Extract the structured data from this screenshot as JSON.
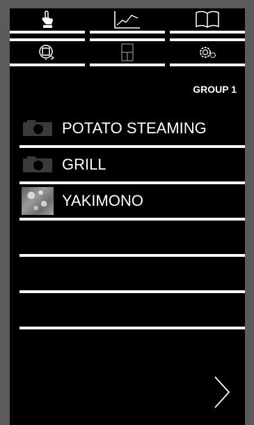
{
  "toolbar": {
    "row1": [
      {
        "icon": "hand-pointer-icon"
      },
      {
        "icon": "line-chart-icon"
      },
      {
        "icon": "book-icon"
      }
    ],
    "row2": [
      {
        "icon": "rotate-frame-icon"
      },
      {
        "icon": "oven-icon"
      },
      {
        "icon": "settings-gears-icon"
      }
    ]
  },
  "group": {
    "label": "GROUP 1"
  },
  "recipes": [
    {
      "name": "POTATO STEAMING",
      "thumb": "camera-icon"
    },
    {
      "name": "GRILL",
      "thumb": "camera-icon"
    },
    {
      "name": "YAKIMONO",
      "thumb": "photo"
    },
    {
      "name": "",
      "thumb": ""
    },
    {
      "name": "",
      "thumb": ""
    },
    {
      "name": "",
      "thumb": ""
    }
  ],
  "navigation": {
    "next_icon": "chevron-right-icon"
  },
  "colors": {
    "background": "#000000",
    "frame": "#5b5b5b",
    "foreground": "#ffffff"
  }
}
